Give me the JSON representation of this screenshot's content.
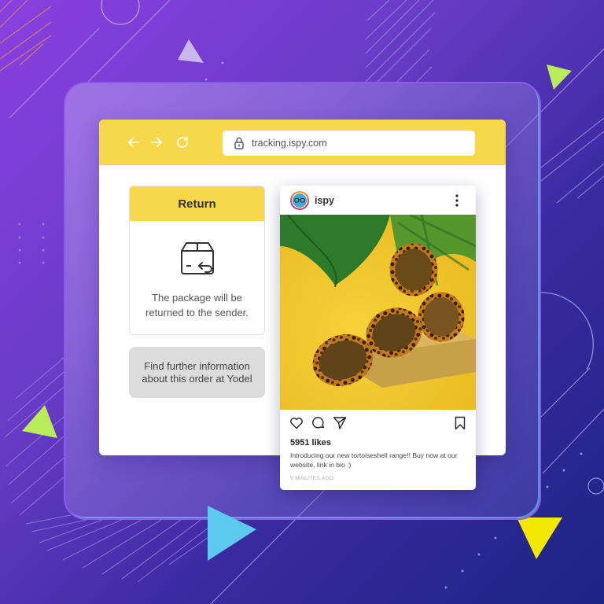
{
  "background": {
    "colors": {
      "gradient_start": "#8a3fe0",
      "gradient_end": "#1c2484",
      "lime": "#b9ec5a",
      "yellow": "#f5e800",
      "cyan": "#5ec9ef",
      "lavender": "#c8b8ee"
    }
  },
  "browser": {
    "nav_icons": [
      "back-arrow-icon",
      "forward-arrow-icon",
      "reload-icon"
    ],
    "url": "tracking.ispy.com",
    "lock_icon": "lock-icon",
    "accent": "#f6d84a"
  },
  "return_card": {
    "title": "Return",
    "icon": "box-return-icon",
    "description_line1": "The package will be",
    "description_line2": "returned to the sender."
  },
  "yodel_button": {
    "line1": "Find further information",
    "line2": "about this order at Yodel"
  },
  "instagram_post": {
    "username": "ispy",
    "avatar_icon": "glasses-icon",
    "menu_icon": "more-vertical-icon",
    "photo_alt": "Two pairs of tortoiseshell cat-eye sunglasses on a cardboard block with palm leaves on yellow background",
    "actions": [
      "heart-icon",
      "comment-icon",
      "send-icon",
      "bookmark-icon"
    ],
    "likes": "5951 likes",
    "caption_line1": "Introducing our new tortoiseshell range!! Buy now at our",
    "caption_line2": "website, link in bio :)",
    "timestamp": "9 MINUTES AGO"
  }
}
